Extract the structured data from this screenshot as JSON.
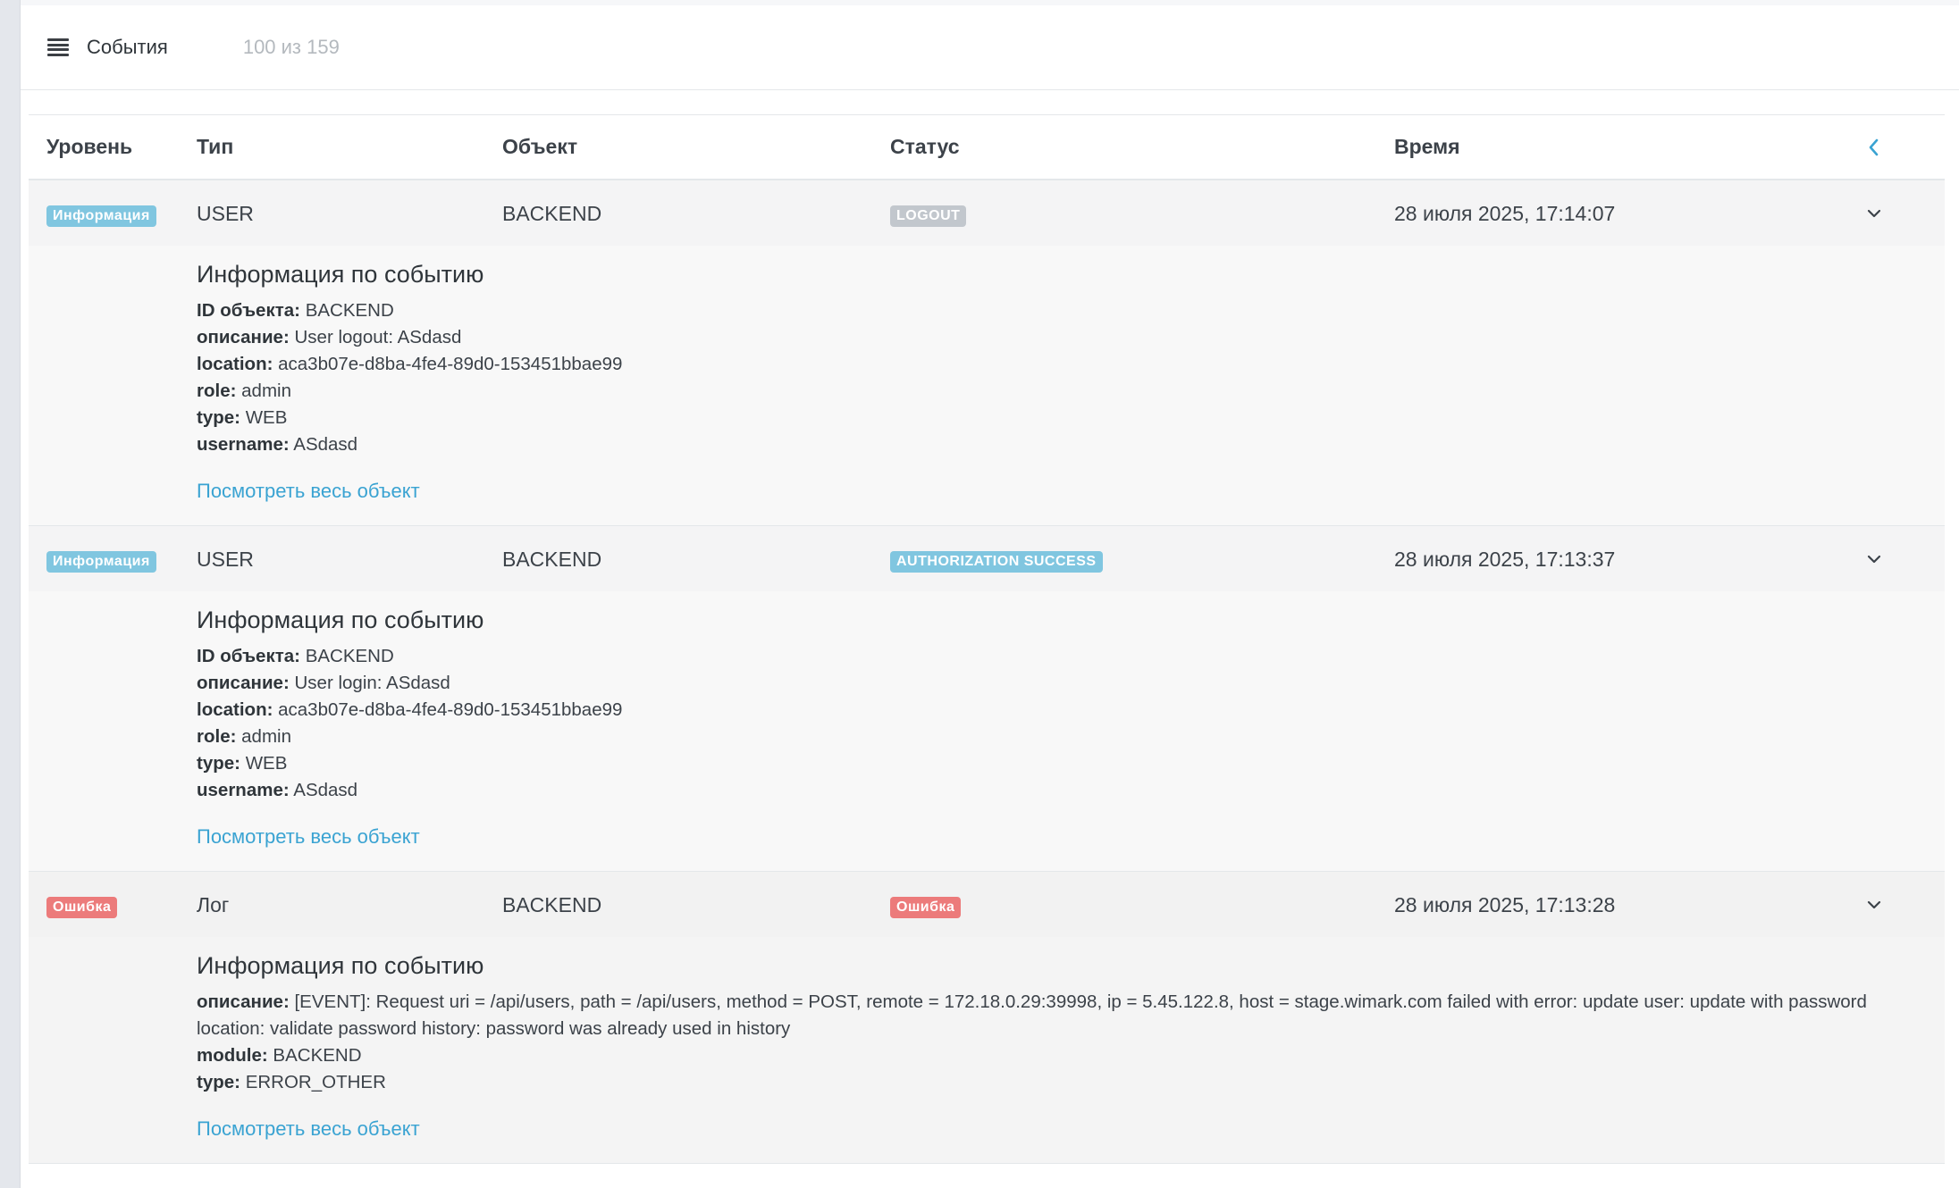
{
  "header": {
    "title": "События",
    "count": "100 из 159"
  },
  "table": {
    "columns": {
      "level": "Уровень",
      "type": "Тип",
      "object": "Объект",
      "status": "Статус",
      "time": "Время"
    }
  },
  "events": [
    {
      "level": "Информация",
      "type": "USER",
      "object": "BACKEND",
      "status": "LOGOUT",
      "time": "28 июля 2025, 17:14:07",
      "details_title": "Информация по событию",
      "fields": [
        {
          "k": "ID объекта:",
          "v": "BACKEND"
        },
        {
          "k": "описание:",
          "v": "User logout: ASdasd"
        },
        {
          "k": "location:",
          "v": "aca3b07e-d8ba-4fe4-89d0-153451bbae99"
        },
        {
          "k": "role:",
          "v": "admin"
        },
        {
          "k": "type:",
          "v": "WEB"
        },
        {
          "k": "username:",
          "v": "ASdasd"
        }
      ],
      "link": "Посмотреть весь объект"
    },
    {
      "level": "Информация",
      "type": "USER",
      "object": "BACKEND",
      "status": "AUTHORIZATION SUCCESS",
      "time": "28 июля 2025, 17:13:37",
      "details_title": "Информация по событию",
      "fields": [
        {
          "k": "ID объекта:",
          "v": "BACKEND"
        },
        {
          "k": "описание:",
          "v": "User login: ASdasd"
        },
        {
          "k": "location:",
          "v": "aca3b07e-d8ba-4fe4-89d0-153451bbae99"
        },
        {
          "k": "role:",
          "v": "admin"
        },
        {
          "k": "type:",
          "v": "WEB"
        },
        {
          "k": "username:",
          "v": "ASdasd"
        }
      ],
      "link": "Посмотреть весь объект"
    },
    {
      "level": "Ошибка",
      "type": "Лог",
      "object": "BACKEND",
      "status": "Ошибка",
      "time": "28 июля 2025, 17:13:28",
      "details_title": "Информация по событию",
      "fields": [
        {
          "k": "описание:",
          "v": "[EVENT]: Request uri = /api/users, path = /api/users, method = POST, remote = 172.18.0.29:39998, ip = 5.45.122.8, host = stage.wimark.com failed with error: update user: update with password location: validate password history: password was already used in history"
        },
        {
          "k": "module:",
          "v": "BACKEND"
        },
        {
          "k": "type:",
          "v": "ERROR_OTHER"
        }
      ],
      "link": "Посмотреть весь объект"
    }
  ],
  "colors": {
    "info_badge": "#80c6e0",
    "logout_badge": "#c2c7cd",
    "error_badge": "#ec7b7b",
    "link": "#3aa3d2"
  }
}
